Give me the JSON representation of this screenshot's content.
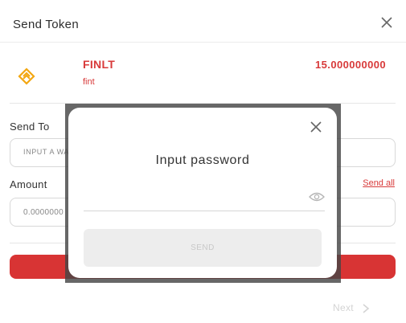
{
  "header": {
    "title": "Send Token"
  },
  "token": {
    "symbol": "FINLT",
    "name": "fint",
    "balance": "15.000000000"
  },
  "form": {
    "send_to_label": "Send To",
    "address_placeholder": "INPUT A WA",
    "amount_label": "Amount",
    "amount_value": "0.0000000",
    "send_all_label": "Send all"
  },
  "footer": {
    "next_label": "Next"
  },
  "dialog": {
    "title": "Input password",
    "password_value": "",
    "submit_label": "SEND"
  },
  "colors": {
    "accent": "#d83a3a",
    "primary_button": "#d83434",
    "overlay": "#464646"
  },
  "icons": {
    "close": "close-icon",
    "token": "token-logo-icon",
    "eye": "eye-icon",
    "next": "chevron-right-icon"
  }
}
